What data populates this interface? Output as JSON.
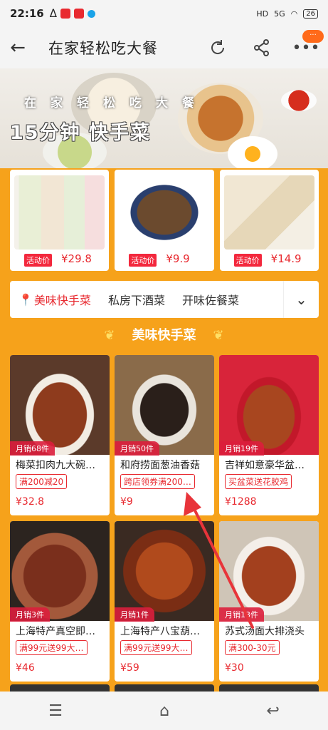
{
  "status_bar": {
    "time": "22:16",
    "signal": "5G",
    "battery": "26"
  },
  "nav": {
    "title": "在家轻松吃大餐",
    "notif": "···"
  },
  "banner": {
    "slogan_top": "在家轻松吃大餐",
    "slogan": "15分钟 快手菜"
  },
  "promos": [
    {
      "tag": "活动价",
      "price": "¥29.8"
    },
    {
      "tag": "活动价",
      "price": "¥9.9"
    },
    {
      "tag": "活动价",
      "price": "¥14.9"
    }
  ],
  "categories": [
    {
      "label": "美味快手菜",
      "active": true
    },
    {
      "label": "私房下酒菜",
      "active": false
    },
    {
      "label": "开味佐餐菜",
      "active": false
    }
  ],
  "section_title": "美味快手菜",
  "products": [
    {
      "sales": "月销68件",
      "name": "梅菜扣肉九大碗…",
      "tag": "满200减20",
      "price": "¥32.8"
    },
    {
      "sales": "月销50件",
      "name": "和府捞面葱油香菇",
      "tag": "跨店领券满200…",
      "price": "¥9"
    },
    {
      "sales": "月销19件",
      "name": "吉祥如意豪华盆…",
      "tag": "买盆菜送花胶鸡",
      "price": "¥1288"
    },
    {
      "sales": "月销3件",
      "name": "上海特产真空即…",
      "tag": "满99元送99大…",
      "price": "¥46"
    },
    {
      "sales": "月销1件",
      "name": "上海特产八宝葫…",
      "tag": "满99元送99大…",
      "price": "¥59"
    },
    {
      "sales": "月销13件",
      "name": "苏式汤面大排浇头",
      "tag": "满300-30元",
      "price": "¥30"
    }
  ],
  "colors": {
    "accent": "#e8292f",
    "background": "#f6a21b"
  }
}
